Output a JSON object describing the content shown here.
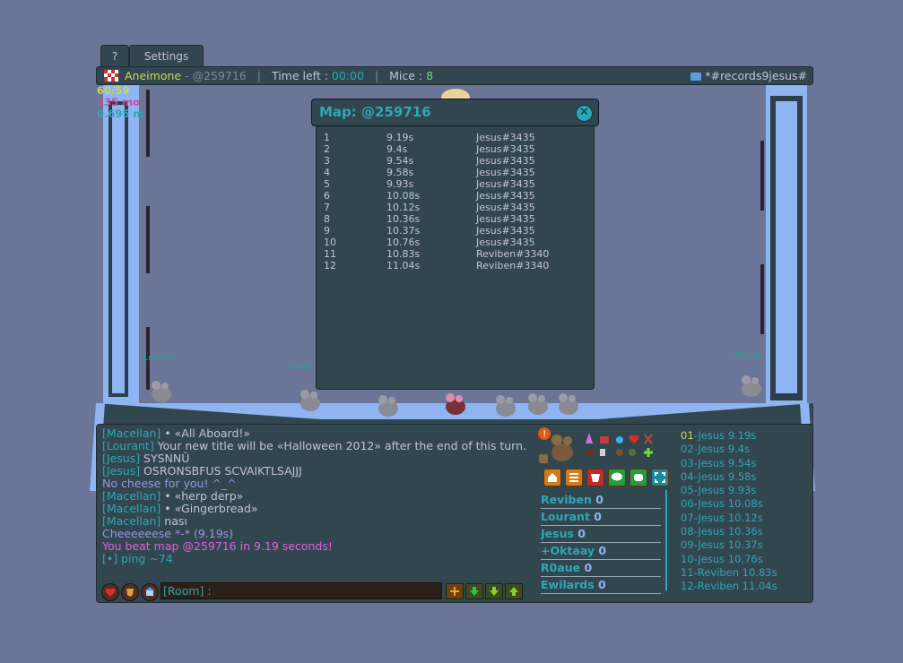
{
  "tabs": {
    "help": "?",
    "settings": "Settings"
  },
  "topbar": {
    "map_author": "Aneimone",
    "map_code": "- @259716",
    "time_left_label": "Time left : ",
    "time_left_value": "00:00",
    "mice_label": "Mice : ",
    "mice_value": "8",
    "room_name": "*#records9jesus#"
  },
  "stats": {
    "line1": "60/59",
    "line2": "135 mo",
    "line3": "0.695 m"
  },
  "scene_names": {
    "lourant": "Lourant",
    "ewila": "Ewila",
    "r0aue": "R0aue"
  },
  "dialog": {
    "title": "Map: @259716",
    "close": "✕",
    "records": [
      {
        "rank": "1",
        "time": "9.19s",
        "player": "Jesus#3435"
      },
      {
        "rank": "2",
        "time": "9.4s",
        "player": "Jesus#3435"
      },
      {
        "rank": "3",
        "time": "9.54s",
        "player": "Jesus#3435"
      },
      {
        "rank": "4",
        "time": "9.58s",
        "player": "Jesus#3435"
      },
      {
        "rank": "5",
        "time": "9.93s",
        "player": "Jesus#3435"
      },
      {
        "rank": "6",
        "time": "10.08s",
        "player": "Jesus#3435"
      },
      {
        "rank": "7",
        "time": "10.12s",
        "player": "Jesus#3435"
      },
      {
        "rank": "8",
        "time": "10.36s",
        "player": "Jesus#3435"
      },
      {
        "rank": "9",
        "time": "10.37s",
        "player": "Jesus#3435"
      },
      {
        "rank": "10",
        "time": "10.76s",
        "player": "Jesus#3435"
      },
      {
        "rank": "11",
        "time": "10.83s",
        "player": "Reviben#3340"
      },
      {
        "rank": "12",
        "time": "11.04s",
        "player": "Reviben#3340"
      }
    ]
  },
  "chat": {
    "l1_name": "[Macellan]",
    "l1_text": " • «All Aboard!»",
    "l2_name": "[Lourant]",
    "l2_text": " Your new title will be «Halloween 2012» after the end of this turn.",
    "l3_name": "[Jesus]",
    "l3_text": " SYSNNÜ",
    "l4_name": "[Jesus]",
    "l4_text": " OSRONSBFUS SCVAIKTLSAJJJ",
    "l5_text": "No cheese for you! ^_^",
    "l6_name": "[Macellan]",
    "l6_text": " • «herp derp»",
    "l7_name": "[Macellan]",
    "l7_text": " • «Gingerbread»",
    "l8_name": "[Macellan]",
    "l8_text": " nası",
    "l9_text": "Cheeeeeese *-* (9.19s)",
    "l10_text": "You beat map @259716 in 9.19 seconds!",
    "l11_text": "[•] ping ~74"
  },
  "chat_input": {
    "room_label": "[Room] :"
  },
  "players": [
    {
      "name": "Reviben",
      "score": "0"
    },
    {
      "name": "Lourant",
      "score": "0"
    },
    {
      "name": "Jesus",
      "score": "0"
    },
    {
      "name": "+Oktaay",
      "score": "0"
    },
    {
      "name": "R0aue",
      "score": "0"
    },
    {
      "name": "Ewilards",
      "score": "0"
    }
  ],
  "leaderboard": [
    {
      "rank": "01",
      "text": "-Jesus 9.19s"
    },
    {
      "rank": "02",
      "text": "-Jesus 9.4s"
    },
    {
      "rank": "03",
      "text": "-Jesus 9.54s"
    },
    {
      "rank": "04",
      "text": "-Jesus 9.58s"
    },
    {
      "rank": "05",
      "text": "-Jesus 9.93s"
    },
    {
      "rank": "06",
      "text": "-Jesus 10.08s"
    },
    {
      "rank": "07",
      "text": "-Jesus 10.12s"
    },
    {
      "rank": "08",
      "text": "-Jesus 10.36s"
    },
    {
      "rank": "09",
      "text": "-Jesus 10.37s"
    },
    {
      "rank": "10",
      "text": "-Jesus 10.76s"
    },
    {
      "rank": "11",
      "text": "-Reviben 10.83s"
    },
    {
      "rank": "12",
      "text": "-Reviben 11.04s"
    }
  ]
}
